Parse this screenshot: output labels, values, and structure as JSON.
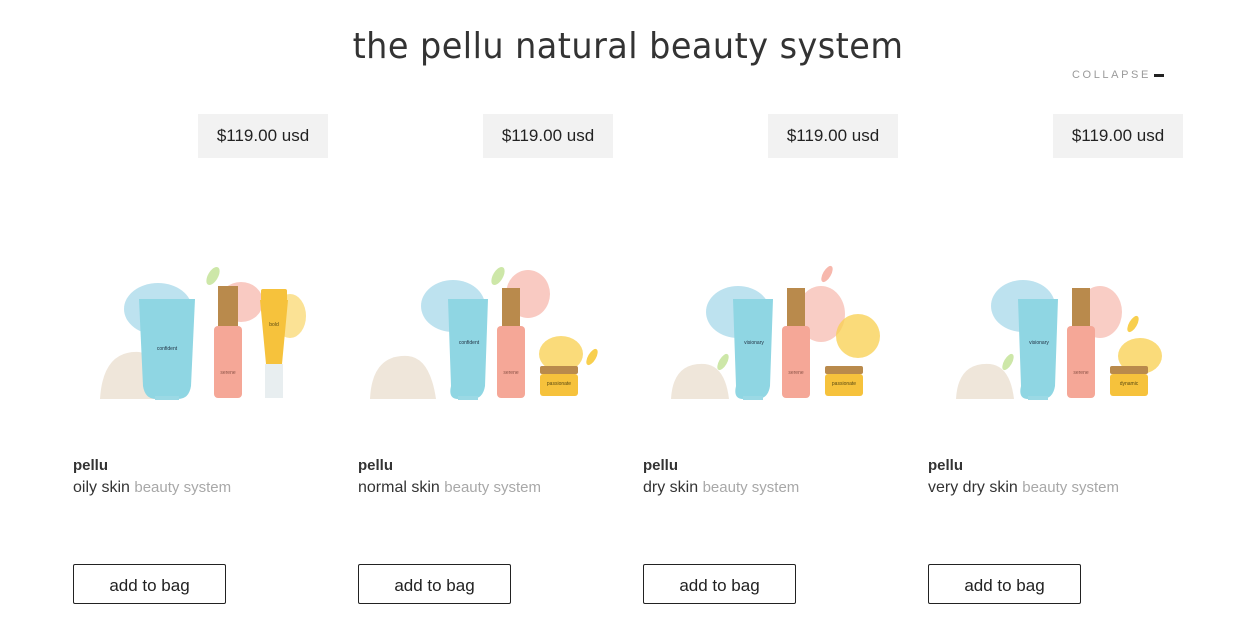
{
  "header": {
    "title": "the pellu natural beauty system",
    "collapse_label": "COLLAPSE",
    "collapse_icon": "minus-icon"
  },
  "products": [
    {
      "price": "$119.00 usd",
      "brand": "pellu",
      "skin_type": "oily skin",
      "suffix": "beauty system",
      "button": "add to bag",
      "image": {
        "cleanser": "confident",
        "serum": "serene",
        "third": "bold",
        "third_kind": "pump-tube"
      }
    },
    {
      "price": "$119.00 usd",
      "brand": "pellu",
      "skin_type": "normal skin",
      "suffix": "beauty system",
      "button": "add to bag",
      "image": {
        "cleanser": "confident",
        "serum": "serene",
        "third": "passionate",
        "third_kind": "jar"
      }
    },
    {
      "price": "$119.00 usd",
      "brand": "pellu",
      "skin_type": "dry skin",
      "suffix": "beauty system",
      "button": "add to bag",
      "image": {
        "cleanser": "visionary",
        "serum": "serene",
        "third": "passionate",
        "third_kind": "jar"
      }
    },
    {
      "price": "$119.00 usd",
      "brand": "pellu",
      "skin_type": "very dry skin",
      "suffix": "beauty system",
      "button": "add to bag",
      "image": {
        "cleanser": "visionary",
        "serum": "serene",
        "third": "dynamic",
        "third_kind": "jar"
      }
    }
  ],
  "colors": {
    "cleanser_blue": "#8fd6e3",
    "serum_pink": "#f5a797",
    "gold_cap": "#b98a4c",
    "jar_yellow": "#f6c23c",
    "sponge": "#efe6da",
    "splash_blue": "#a7d8ea",
    "splash_pink": "#f7b8ad",
    "splash_yellow": "#f8cf4e",
    "splash_green": "#cde7a8"
  }
}
